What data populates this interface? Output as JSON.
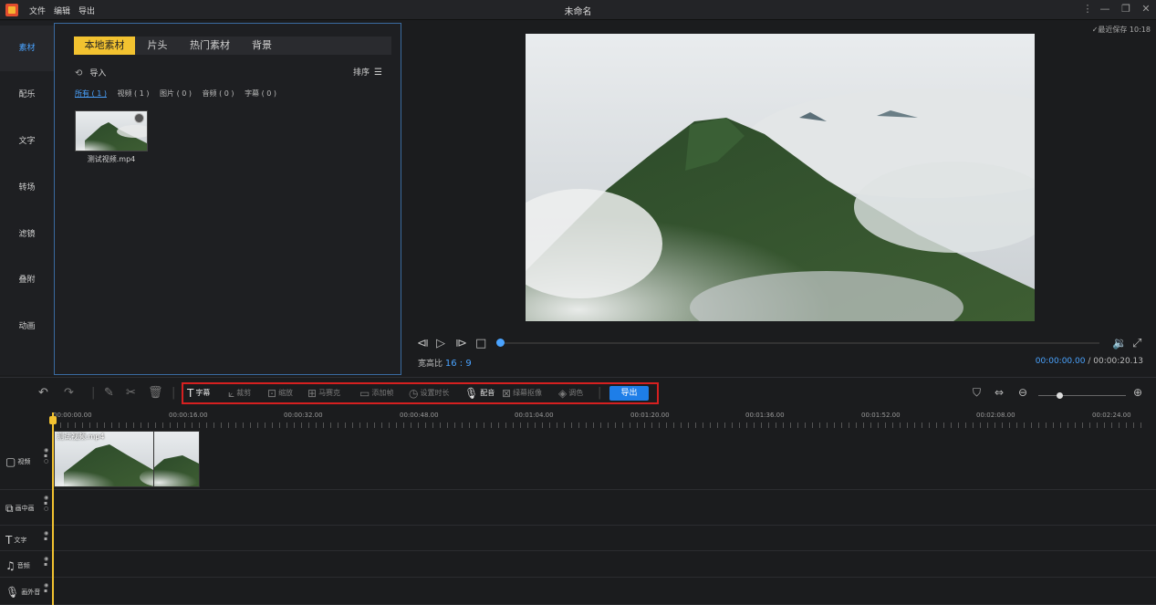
{
  "titlebar": {
    "menu": [
      "文件",
      "编辑",
      "导出"
    ],
    "title": "未命名",
    "controls": [
      "⋮",
      "—",
      "❐",
      "✕"
    ]
  },
  "nav": {
    "items": [
      "素材",
      "配乐",
      "文字",
      "转场",
      "滤镜",
      "叠附",
      "动画"
    ],
    "active_index": 0
  },
  "media_panel": {
    "tabs": [
      "本地素材",
      "片头",
      "热门素材",
      "背景"
    ],
    "active_tab": 0,
    "import_label": "导入",
    "sort_label": "排序",
    "filters": [
      "所有 ( 1 )",
      "视频 ( 1 )",
      "图片 ( 0 )",
      "音频 ( 0 )",
      "字幕 ( 0 )"
    ],
    "active_filter": 0,
    "items": [
      {
        "name": "测试视频.mp4"
      }
    ]
  },
  "preview": {
    "last_saved": "最近保存 10:18",
    "ratio_label": "宽高比",
    "ratio_value": "16 : 9",
    "current_time": "00:00:00.00",
    "separator": "/",
    "total_time": "00:00:20.13",
    "progress": 0.0
  },
  "toolbar": {
    "tools": [
      {
        "label": "字幕",
        "icon": "text-T-icon",
        "enabled": true
      },
      {
        "label": "裁剪",
        "icon": "crop-icon",
        "enabled": false
      },
      {
        "label": "缩放",
        "icon": "zoom-frame-icon",
        "enabled": false
      },
      {
        "label": "马赛克",
        "icon": "mosaic-icon",
        "enabled": false
      },
      {
        "label": "添加帧",
        "icon": "add-frame-icon",
        "enabled": false
      },
      {
        "label": "设置时长",
        "icon": "clock-icon",
        "enabled": false
      },
      {
        "label": "配音",
        "icon": "microphone-icon",
        "enabled": true
      },
      {
        "label": "绿幕抠像",
        "icon": "green-screen-icon",
        "enabled": false
      },
      {
        "label": "调色",
        "icon": "color-icon",
        "enabled": false
      }
    ],
    "export_label": "导出",
    "zoom_level": 0.2
  },
  "timeline": {
    "ticks": [
      "00:00:00.00",
      "00:00:16.00",
      "00:00:32.00",
      "00:00:48.00",
      "00:01:04.00",
      "00:01:20.00",
      "00:01:36.00",
      "00:01:52.00",
      "00:02:08.00",
      "00:02:24.00"
    ],
    "tracks": [
      {
        "label": "视频",
        "icon": "video-icon"
      },
      {
        "label": "画中画",
        "icon": "pip-icon"
      },
      {
        "label": "文字",
        "icon": "text-icon"
      },
      {
        "label": "音频",
        "icon": "music-icon"
      },
      {
        "label": "画外音",
        "icon": "microphone-icon"
      }
    ],
    "clip": {
      "name": "测试视频.mp4"
    }
  },
  "colors": {
    "accent_blue": "#4aa3ff",
    "accent_yellow": "#f2c230",
    "highlight_red": "#d62020",
    "export_blue": "#1e7ee8"
  }
}
